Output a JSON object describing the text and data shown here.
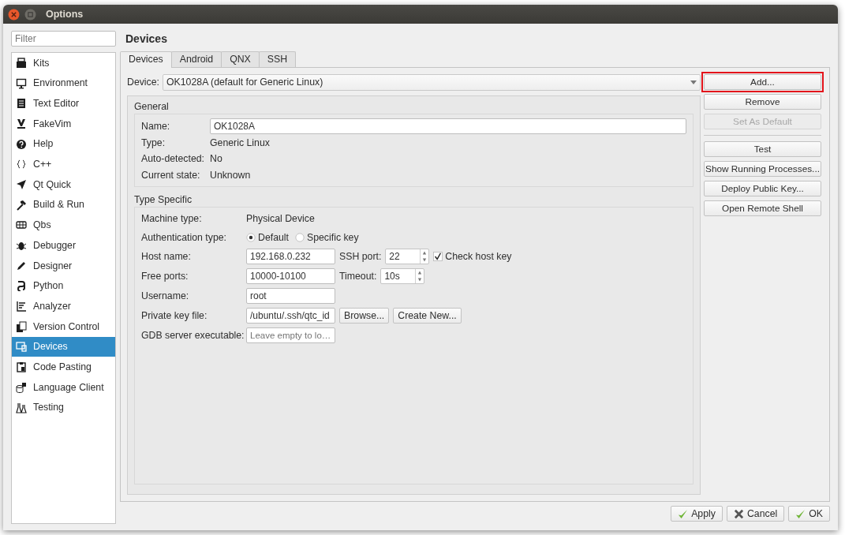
{
  "window": {
    "title": "Options"
  },
  "filter": {
    "placeholder": "Filter"
  },
  "sidebar": {
    "items": [
      {
        "label": "Kits",
        "selected": false
      },
      {
        "label": "Environment",
        "selected": false
      },
      {
        "label": "Text Editor",
        "selected": false
      },
      {
        "label": "FakeVim",
        "selected": false
      },
      {
        "label": "Help",
        "selected": false
      },
      {
        "label": "C++",
        "selected": false
      },
      {
        "label": "Qt Quick",
        "selected": false
      },
      {
        "label": "Build & Run",
        "selected": false
      },
      {
        "label": "Qbs",
        "selected": false
      },
      {
        "label": "Debugger",
        "selected": false
      },
      {
        "label": "Designer",
        "selected": false
      },
      {
        "label": "Python",
        "selected": false
      },
      {
        "label": "Analyzer",
        "selected": false
      },
      {
        "label": "Version Control",
        "selected": false
      },
      {
        "label": "Devices",
        "selected": true
      },
      {
        "label": "Code Pasting",
        "selected": false
      },
      {
        "label": "Language Client",
        "selected": false
      },
      {
        "label": "Testing",
        "selected": false
      }
    ]
  },
  "page_title": "Devices",
  "tabs": [
    {
      "label": "Devices",
      "selected": true
    },
    {
      "label": "Android",
      "selected": false
    },
    {
      "label": "QNX",
      "selected": false
    },
    {
      "label": "SSH",
      "selected": false
    }
  ],
  "device": {
    "label": "Device:",
    "value": "OK1028A (default for Generic Linux)"
  },
  "button_groups": [
    [
      {
        "label": "Add...",
        "disabled": false,
        "highlighted": true
      },
      {
        "label": "Remove",
        "disabled": false,
        "highlighted": false
      },
      {
        "label": "Set As Default",
        "disabled": true,
        "highlighted": false
      }
    ],
    [
      {
        "label": "Test",
        "disabled": false,
        "highlighted": false
      },
      {
        "label": "Show Running Processes...",
        "disabled": false,
        "highlighted": false
      },
      {
        "label": "Deploy Public Key...",
        "disabled": false,
        "highlighted": false
      },
      {
        "label": "Open Remote Shell",
        "disabled": false,
        "highlighted": false
      }
    ]
  ],
  "general": {
    "title": "General",
    "fields": [
      {
        "label": "Name:",
        "kind": "input",
        "value": "OK1028A"
      },
      {
        "label": "Type:",
        "kind": "text",
        "value": "Generic Linux"
      },
      {
        "label": "Auto-detected:",
        "kind": "text",
        "value": "No"
      },
      {
        "label": "Current state:",
        "kind": "text",
        "value": "Unknown"
      }
    ]
  },
  "type_specific": {
    "title": "Type Specific",
    "rows": [
      {
        "label": "Machine type:",
        "kind": "text",
        "value": "Physical Device"
      },
      {
        "label": "Authentication type:",
        "kind": "radio",
        "options": [
          {
            "label": "Default",
            "selected": true
          },
          {
            "label": "Specific key",
            "selected": false
          }
        ]
      },
      {
        "label": "Host name:",
        "kind": "input",
        "value": "192.168.0.232",
        "extras": [
          {
            "kind": "spin",
            "label": "SSH port:",
            "value": "22"
          },
          {
            "kind": "checkbox",
            "label": "Check host key",
            "checked": true
          }
        ]
      },
      {
        "label": "Free ports:",
        "kind": "input",
        "value": "10000-10100",
        "extras": [
          {
            "kind": "spin",
            "label": "Timeout:",
            "value": "10s"
          }
        ]
      },
      {
        "label": "Username:",
        "kind": "input",
        "value": "root"
      },
      {
        "label": "Private key file:",
        "kind": "input",
        "value": "/ubuntu/.ssh/qtc_id",
        "extras": [
          {
            "kind": "button",
            "label": "Browse..."
          },
          {
            "kind": "button",
            "label": "Create New..."
          }
        ]
      },
      {
        "label": "GDB server executable:",
        "kind": "input",
        "placeholder": "Leave empty to lo…"
      }
    ]
  },
  "footer_buttons": [
    {
      "label": "Apply",
      "kind": "apply"
    },
    {
      "label": "Cancel",
      "kind": "cancel"
    },
    {
      "label": "OK",
      "kind": "ok"
    }
  ]
}
